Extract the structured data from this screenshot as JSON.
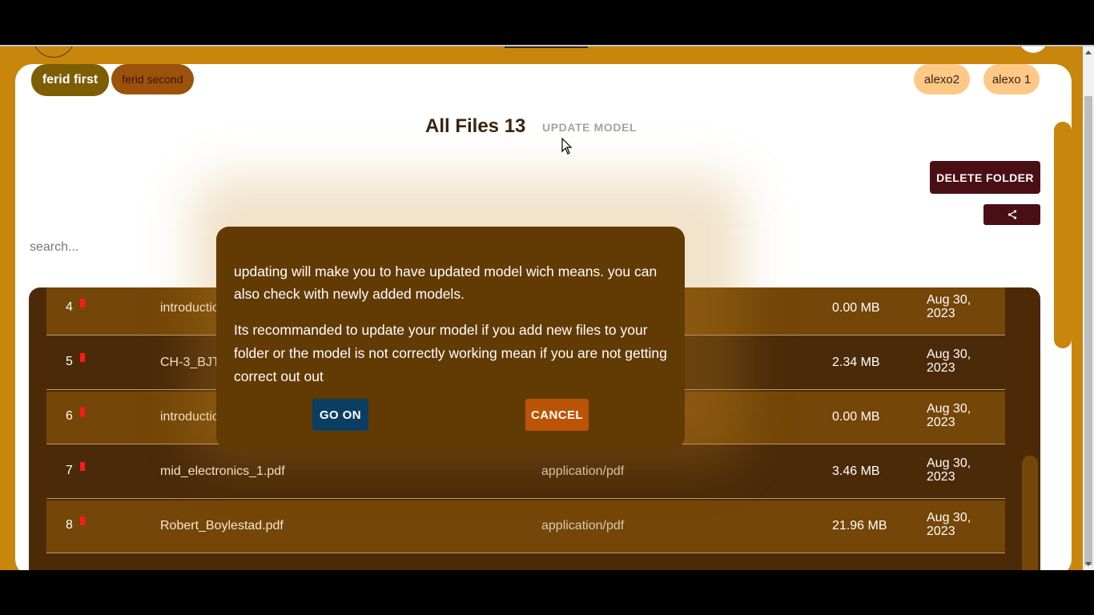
{
  "chips": {
    "ferid_first": "ferid first",
    "ferid_second": "ferid second",
    "alexo2": "alexo2",
    "alexo1": "alexo 1"
  },
  "header": {
    "title": "All Files 13",
    "update_model": "UPDATE MODEL"
  },
  "toolbar": {
    "delete_folder": "DELETE FOLDER",
    "share_icon": "share-icon"
  },
  "search": {
    "placeholder": "search..."
  },
  "files": [
    {
      "num": "4",
      "name": "introductic",
      "type": "",
      "size": "0.00 MB",
      "date": "Aug 30, 2023"
    },
    {
      "num": "5",
      "name": "CH-3_BJT",
      "type": "",
      "size": "2.34 MB",
      "date": "Aug 30, 2023"
    },
    {
      "num": "6",
      "name": "introductic",
      "type": "",
      "size": "0.00 MB",
      "date": "Aug 30, 2023"
    },
    {
      "num": "7",
      "name": "mid_electronics_1.pdf",
      "type": "application/pdf",
      "size": "3.46 MB",
      "date": "Aug 30, 2023"
    },
    {
      "num": "8",
      "name": "Robert_Boylestad.pdf",
      "type": "application/pdf",
      "size": "21.96 MB",
      "date": "Aug 30, 2023"
    }
  ],
  "dialog": {
    "p1": "updating will make you to have updated model wich means. you can also check with newly added models.",
    "p2": "Its recommanded to update your model if you add new files to your folder or the model is not correctly working mean if you are not getting correct out out",
    "go_on": "GO ON",
    "cancel": "CANCEL"
  },
  "colors": {
    "background": "#c8860c",
    "dialog": "#623a04",
    "go_on": "#0b3e63",
    "cancel": "#bb5405",
    "delete": "#4a0f14",
    "flag": "#ff1a1a"
  }
}
